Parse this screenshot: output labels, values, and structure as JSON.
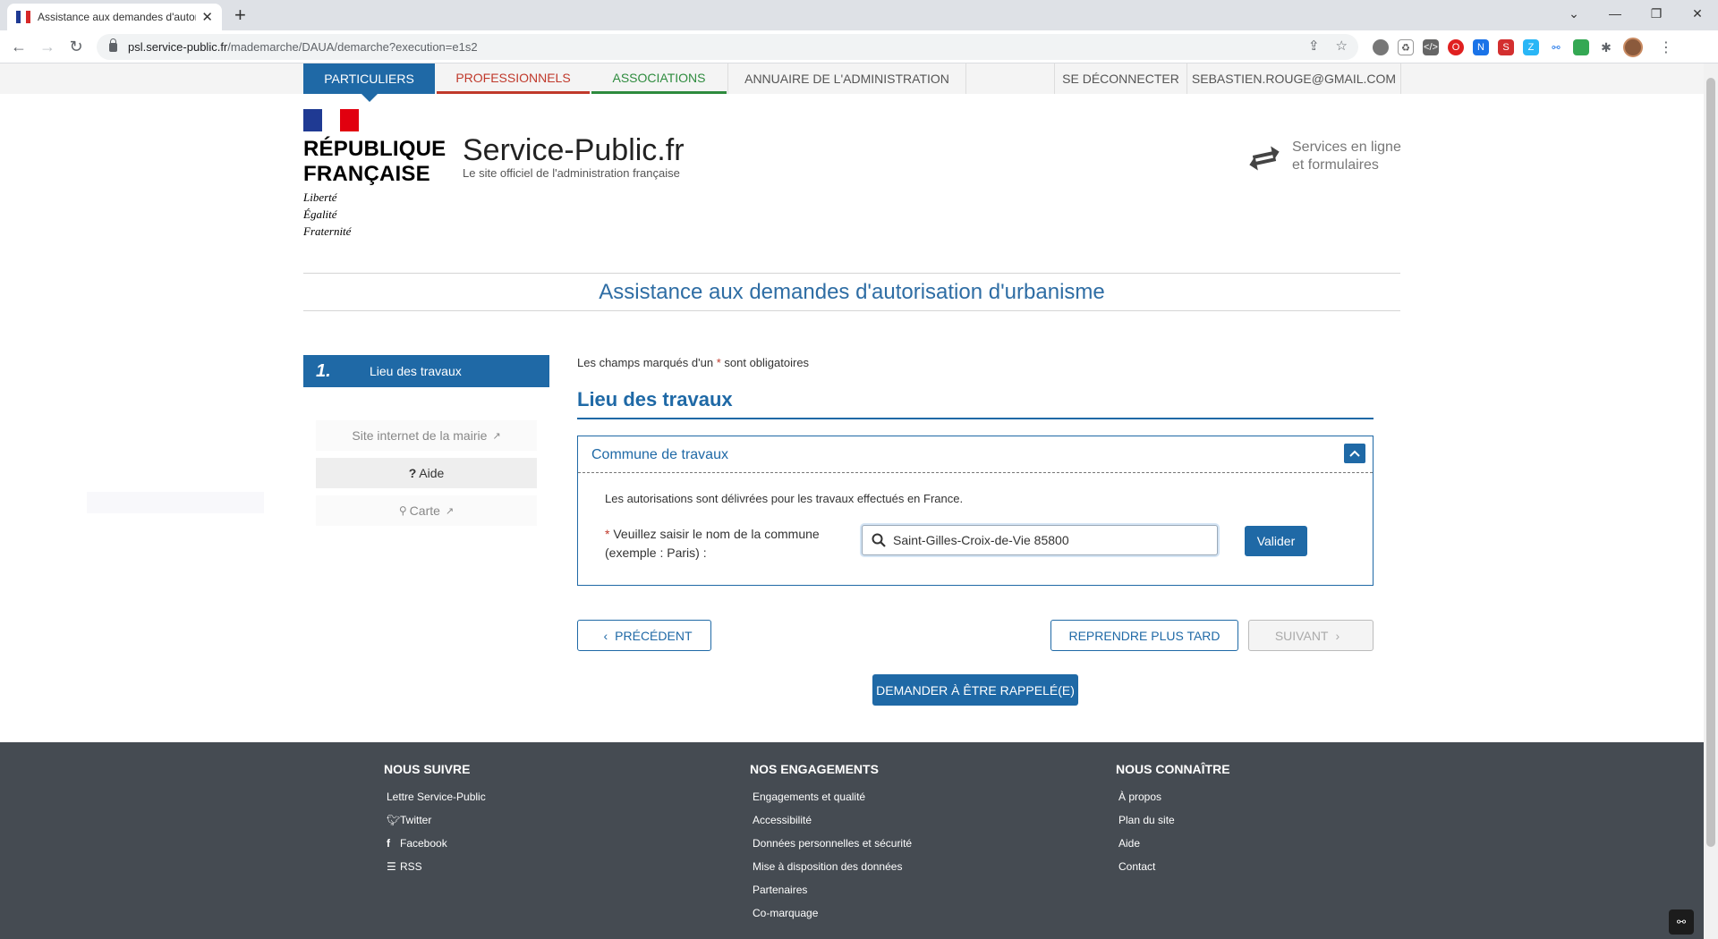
{
  "browser": {
    "tab_title": "Assistance aux demandes d'autor",
    "url_host": "psl.service-public.fr",
    "url_path": "/mademarche/DAUA/demarche?execution=e1s2"
  },
  "topnav": {
    "particuliers": "PARTICULIERS",
    "professionnels": "PROFESSIONNELS",
    "associations": "ASSOCIATIONS",
    "annuaire": "ANNUAIRE DE L'ADMINISTRATION",
    "logout": "SE DÉCONNECTER",
    "email": "SEBASTIEN.ROUGE@GMAIL.COM"
  },
  "header": {
    "rf_line1": "RÉPUBLIQUE",
    "rf_line2": "FRANÇAISE",
    "motto1": "Liberté",
    "motto2": "Égalité",
    "motto3": "Fraternité",
    "brand": "Service-Public.fr",
    "tagline": "Le site officiel de l'administration française",
    "services_line1": "Services en ligne",
    "services_line2": "et formulaires"
  },
  "page_title": "Assistance aux demandes d'autorisation d'urbanisme",
  "sidebar": {
    "step_number": "1.",
    "step_label": "Lieu des travaux",
    "mairie": "Site internet de la mairie",
    "aide": "Aide",
    "carte": "Carte"
  },
  "form": {
    "required_note_before": "Les champs marqués d'un",
    "required_star": "*",
    "required_note_after": "sont obligatoires",
    "section_title": "Lieu des travaux",
    "panel_title": "Commune de travaux",
    "info": "Les autorisations sont délivrées pour les travaux effectués en France.",
    "field_label": "Veuillez saisir le nom de la commune (exemple : Paris) :",
    "commune_value": "Saint-Gilles-Croix-de-Vie 85800",
    "valider": "Valider"
  },
  "actions": {
    "precedent": "PRÉCÉDENT",
    "reprendre": "REPRENDRE PLUS TARD",
    "suivant": "SUIVANT",
    "rappel": "DEMANDER À ÊTRE RAPPELÉ(E)"
  },
  "footer": {
    "col1_title": "NOUS SUIVRE",
    "col1": [
      "Lettre Service-Public",
      "Twitter",
      "Facebook",
      "RSS"
    ],
    "col2_title": "NOS ENGAGEMENTS",
    "col2": [
      "Engagements et qualité",
      "Accessibilité",
      "Données personnelles et sécurité",
      "Mise à disposition des données",
      "Partenaires",
      "Co-marquage"
    ],
    "col3_title": "NOUS CONNAÎTRE",
    "col3": [
      "À propos",
      "Plan du site",
      "Aide",
      "Contact"
    ]
  },
  "colors": {
    "primary": "#1f69a6",
    "professionnels": "#c0392b",
    "associations": "#2e8b3e",
    "footer_bg": "#454b52"
  }
}
